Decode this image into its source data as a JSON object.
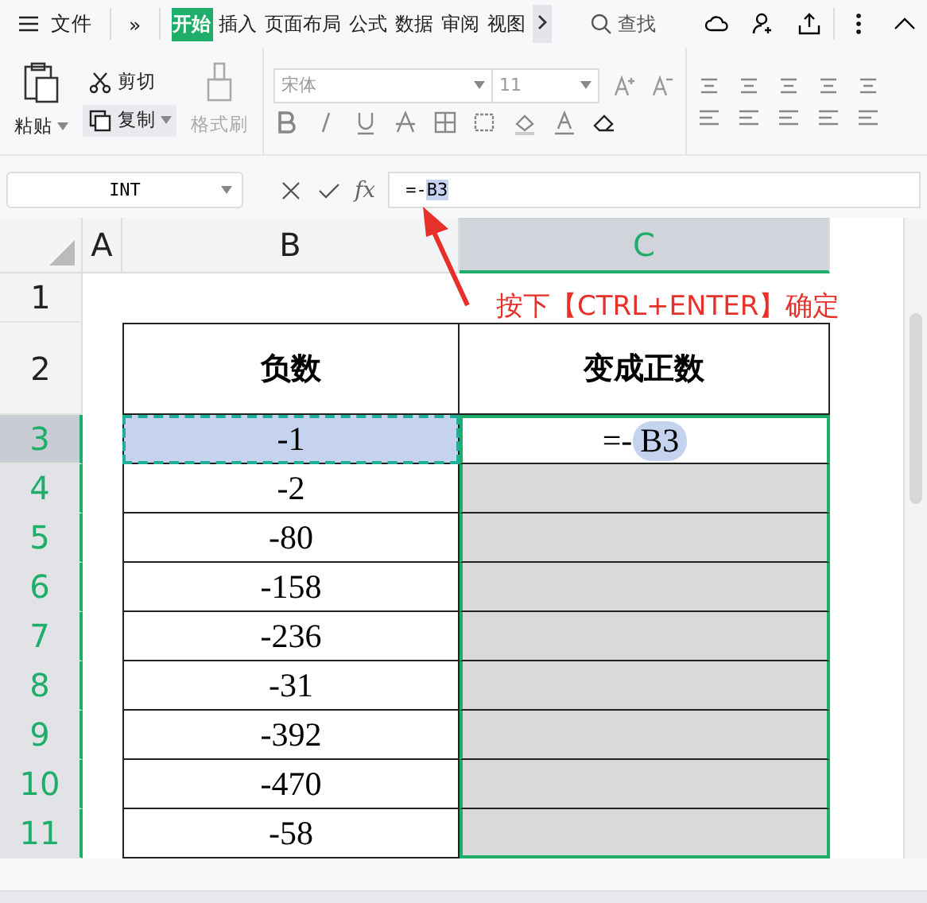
{
  "top_bar": {
    "file_menu": "文件",
    "more": "»",
    "tabs": [
      {
        "label": "开始",
        "selected": true
      },
      {
        "label": "插入",
        "selected": false
      },
      {
        "label": "页面布局",
        "selected": false
      },
      {
        "label": "公式",
        "selected": false
      },
      {
        "label": "数据",
        "selected": false
      },
      {
        "label": "审阅",
        "selected": false
      },
      {
        "label": "视图",
        "selected": false
      }
    ],
    "search": "查找"
  },
  "ribbon": {
    "paste": "粘贴",
    "cut": "剪切",
    "copy": "复制",
    "format_painter": {
      "label": "格式刷",
      "disabled": true
    },
    "font": "宋体",
    "font_size": "11"
  },
  "formula_bar": {
    "name_box": "INT",
    "fx": "fx",
    "formula": "=-",
    "formula_ref": "B3"
  },
  "columns": [
    {
      "label": "A",
      "selected": false
    },
    {
      "label": "B",
      "selected": false
    },
    {
      "label": "C",
      "selected": true
    }
  ],
  "rows": [
    {
      "number": "1",
      "kind": "blank",
      "selected": false
    },
    {
      "number": "2",
      "kind": "header",
      "selected": false,
      "b": {
        "text": "负数"
      },
      "c": {
        "text": "变成正数"
      }
    },
    {
      "number": "3",
      "kind": "data",
      "selected": true,
      "active": true,
      "b": {
        "text": "-1",
        "marquee": true
      },
      "c": {
        "text": "=-",
        "ref": "B3",
        "shaded": false
      }
    },
    {
      "number": "4",
      "kind": "data",
      "selected": true,
      "active": false,
      "b": {
        "text": "-2",
        "marquee": false
      },
      "c": {
        "shaded": true
      }
    },
    {
      "number": "5",
      "kind": "data",
      "selected": true,
      "active": false,
      "b": {
        "text": "-80",
        "marquee": false
      },
      "c": {
        "shaded": true
      }
    },
    {
      "number": "6",
      "kind": "data",
      "selected": true,
      "active": false,
      "b": {
        "text": "-158",
        "marquee": false
      },
      "c": {
        "shaded": true
      }
    },
    {
      "number": "7",
      "kind": "data",
      "selected": true,
      "active": false,
      "b": {
        "text": "-236",
        "marquee": false
      },
      "c": {
        "shaded": true
      }
    },
    {
      "number": "8",
      "kind": "data",
      "selected": true,
      "active": false,
      "b": {
        "text": "-31",
        "marquee": false
      },
      "c": {
        "shaded": true
      }
    },
    {
      "number": "9",
      "kind": "data",
      "selected": true,
      "active": false,
      "b": {
        "text": "-392",
        "marquee": false
      },
      "c": {
        "shaded": true
      }
    },
    {
      "number": "10",
      "kind": "data",
      "selected": true,
      "active": false,
      "b": {
        "text": "-470",
        "marquee": false
      },
      "c": {
        "shaded": true
      }
    },
    {
      "number": "11",
      "kind": "data",
      "selected": true,
      "active": false,
      "b": {
        "text": "-58",
        "marquee": false
      },
      "c": {
        "shaded": true
      }
    }
  ],
  "annotation": {
    "text": "按下【CTRL+ENTER】确定"
  }
}
